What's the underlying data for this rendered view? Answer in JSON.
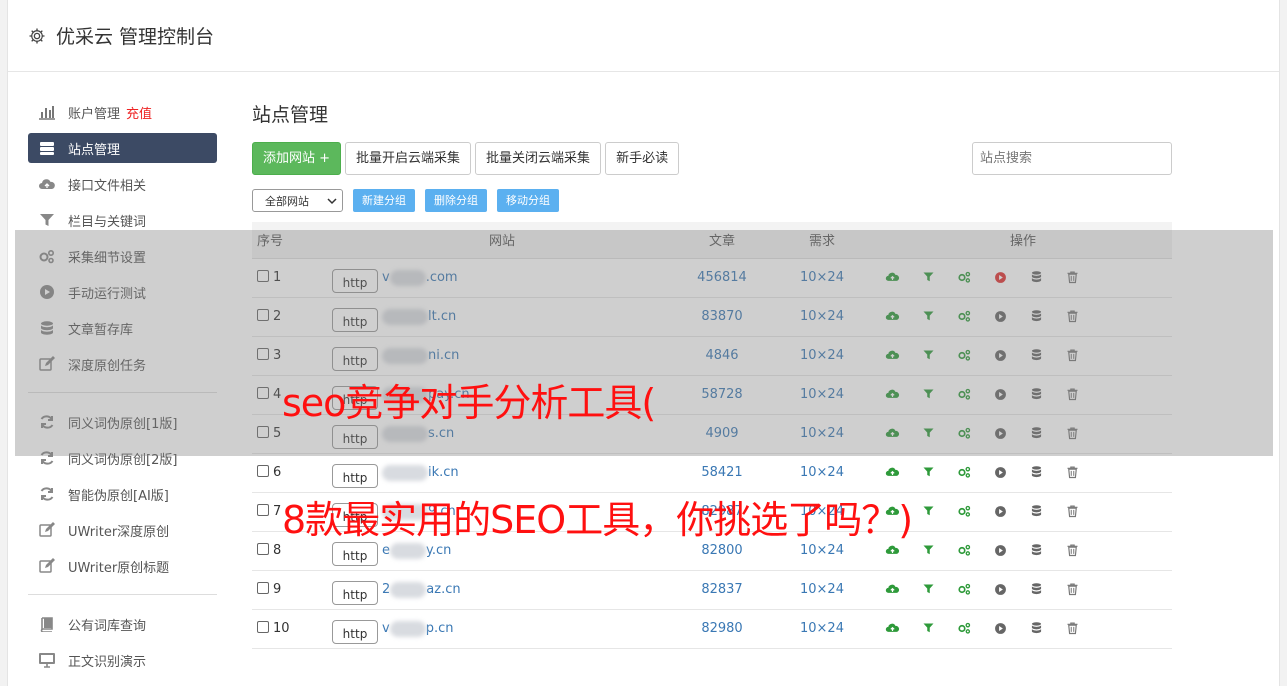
{
  "header": {
    "title": "优采云 管理控制台"
  },
  "sidebar": {
    "account": {
      "label": "账户管理",
      "extra": "充值"
    },
    "group1": [
      {
        "label": "站点管理",
        "icon": "server-icon",
        "active": true
      },
      {
        "label": "接口文件相关",
        "icon": "cloud-upload-icon"
      },
      {
        "label": "栏目与关键词",
        "icon": "filter-icon"
      },
      {
        "label": "采集细节设置",
        "icon": "gears-icon"
      },
      {
        "label": "手动运行测试",
        "icon": "play-icon"
      },
      {
        "label": "文章暂存库",
        "icon": "database-icon"
      },
      {
        "label": "深度原创任务",
        "icon": "edit-icon"
      }
    ],
    "group2": [
      {
        "label": "同义词伪原创[1版]",
        "icon": "refresh-icon"
      },
      {
        "label": "同义词伪原创[2版]",
        "icon": "refresh-icon"
      },
      {
        "label": "智能伪原创[AI版]",
        "icon": "refresh-icon"
      },
      {
        "label": "UWriter深度原创",
        "icon": "edit-icon"
      },
      {
        "label": "UWriter原创标题",
        "icon": "edit-icon"
      }
    ],
    "group3": [
      {
        "label": "公有词库查询",
        "icon": "book-icon"
      },
      {
        "label": "正文识别演示",
        "icon": "monitor-icon"
      }
    ]
  },
  "main": {
    "title": "站点管理",
    "buttons": {
      "add": "添加网站 +",
      "batch_open": "批量开启云端采集",
      "batch_close": "批量关闭云端采集",
      "guide": "新手必读"
    },
    "search_placeholder": "站点搜索",
    "group_select": "全部网站",
    "group_buttons": {
      "new": "新建分组",
      "delete": "删除分组",
      "move": "移动分组"
    },
    "table": {
      "headers": {
        "no": "序号",
        "site": "网站",
        "articles": "文章",
        "demand": "需求",
        "ops": "操作"
      },
      "rows": [
        {
          "no": "1",
          "proto": "http",
          "prefix": "v",
          "suffix": ".com",
          "articles": "456814",
          "demand": "10×24",
          "running": true
        },
        {
          "no": "2",
          "proto": "http",
          "prefix": "",
          "suffix": "lt.cn",
          "articles": "83870",
          "demand": "10×24",
          "running": false
        },
        {
          "no": "3",
          "proto": "http",
          "prefix": "",
          "suffix": "ni.cn",
          "articles": "4846",
          "demand": "10×24",
          "running": false
        },
        {
          "no": "4",
          "proto": "http",
          "prefix": "",
          "suffix": "pay.cn",
          "articles": "58728",
          "demand": "10×24",
          "running": false
        },
        {
          "no": "5",
          "proto": "http",
          "prefix": "",
          "suffix": "s.cn",
          "articles": "4909",
          "demand": "10×24",
          "running": false
        },
        {
          "no": "6",
          "proto": "http",
          "prefix": "",
          "suffix": "ik.cn",
          "articles": "58421",
          "demand": "10×24",
          "running": false
        },
        {
          "no": "7",
          "proto": "http",
          "prefix": "",
          "suffix": "9.cn",
          "articles": "82987",
          "demand": "10×24",
          "running": false
        },
        {
          "no": "8",
          "proto": "http",
          "prefix": "e",
          "suffix": "y.cn",
          "articles": "82800",
          "demand": "10×24",
          "running": false
        },
        {
          "no": "9",
          "proto": "http",
          "prefix": "2",
          "suffix": "az.cn",
          "articles": "82837",
          "demand": "10×24",
          "running": false
        },
        {
          "no": "10",
          "proto": "http",
          "prefix": "v",
          "suffix": "p.cn",
          "articles": "82980",
          "demand": "10×24",
          "running": false
        }
      ]
    }
  },
  "overlay": {
    "line1": "seo竞争对手分析工具(",
    "line2": "8款最实用的SEO工具，你挑选了吗？)"
  },
  "colors": {
    "accent_green": "#5cb85c",
    "sidebar_active": "#3c4a64",
    "link_blue": "#3a78b4",
    "overlay_text": "#ff1010",
    "run_red": "#e03030"
  }
}
